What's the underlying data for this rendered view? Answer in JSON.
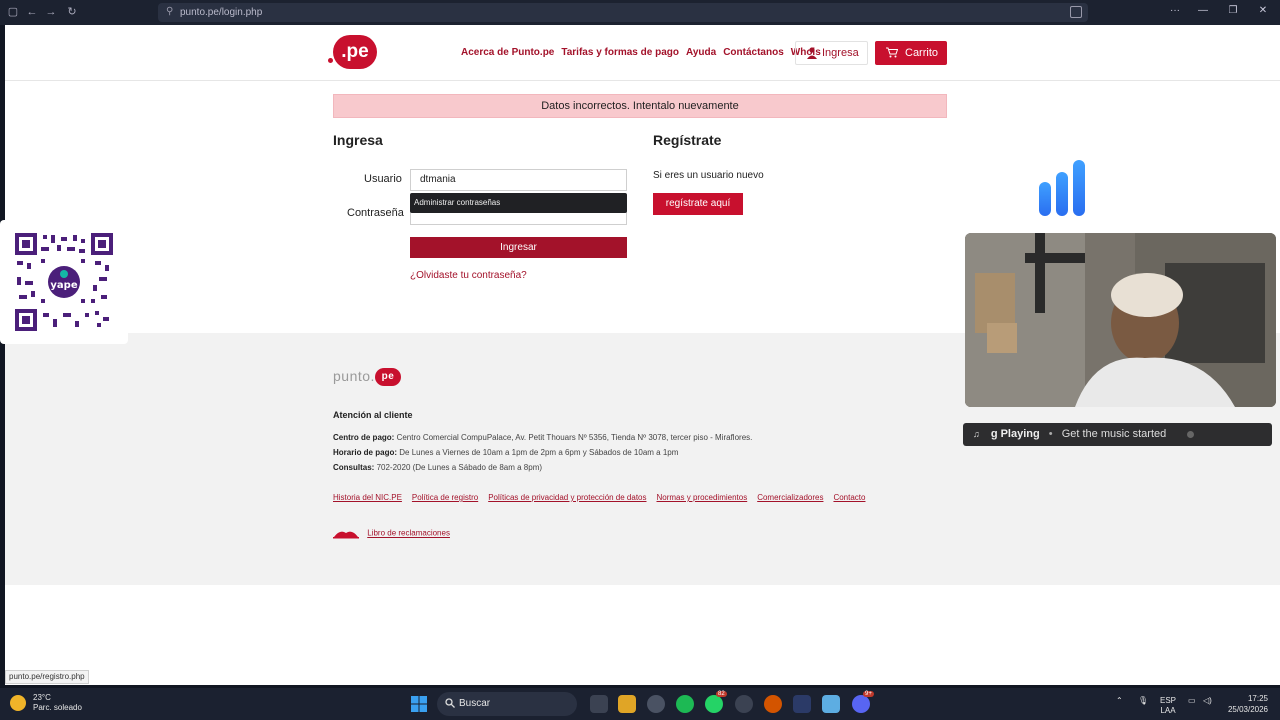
{
  "browser": {
    "url": "punto.pe/login.php"
  },
  "header": {
    "logo_text": ".pe",
    "nav": [
      "Acerca de Punto.pe",
      "Tarifas y formas de pago",
      "Ayuda",
      "Contáctanos",
      "Whois"
    ],
    "login_button": "Ingresa",
    "cart_button": "Carrito"
  },
  "alert": "Datos incorrectos. Intentalo nuevamente",
  "login": {
    "title": "Ingresa",
    "user_label": "Usuario",
    "user_value": "dtmania",
    "autofill_hint": "Administrar contraseñas",
    "password_label": "Contraseña",
    "submit": "Ingresar",
    "forgot": "¿Olvidaste tu contraseña?"
  },
  "register": {
    "title": "Regístrate",
    "subtitle": "Si eres un usuario nuevo",
    "button": "regístrate aquí"
  },
  "footer": {
    "logo_text": "punto.",
    "logo_pe": "pe",
    "atencion": "Atención al cliente",
    "centro_label": "Centro de pago:",
    "centro_value": "Centro Comercial CompuPalace, Av. Petit Thouars Nº 5356, Tienda Nº 3078, tercer piso - Miraflores.",
    "horario_label": "Horario de pago:",
    "horario_value": "De Lunes a Viernes de 10am a 1pm de 2pm a 6pm y Sábados de 10am a 1pm",
    "consultas_label": "Consultas:",
    "consultas_value": "702-2020 (De Lunes a Sábado de 8am a 8pm)",
    "links": [
      "Historia del NIC.PE",
      "Política de registro",
      "Políticas de privacidad y protección de datos",
      "Normas y procedimientos",
      "Comercializadores",
      "Contacto"
    ],
    "libro": "Libro de reclamaciones"
  },
  "status_url": "punto.pe/registro.php",
  "overlay": {
    "qr_text": "yape",
    "music_now": "g Playing",
    "music_msg": "Get the music started"
  },
  "taskbar": {
    "temp": "23°C",
    "weather": "Parc. soleado",
    "search": "Buscar",
    "lang1": "ESP",
    "lang2": "LAA",
    "time": "17:25",
    "date": "25/03/2026",
    "badge_whatsapp": "82",
    "badge_discord": "9+"
  },
  "colors": {
    "brand_red": "#c8102e",
    "dark_red": "#a3122a",
    "alert_bg": "#f8c9cd",
    "footer_bg": "#f2f2f2"
  }
}
